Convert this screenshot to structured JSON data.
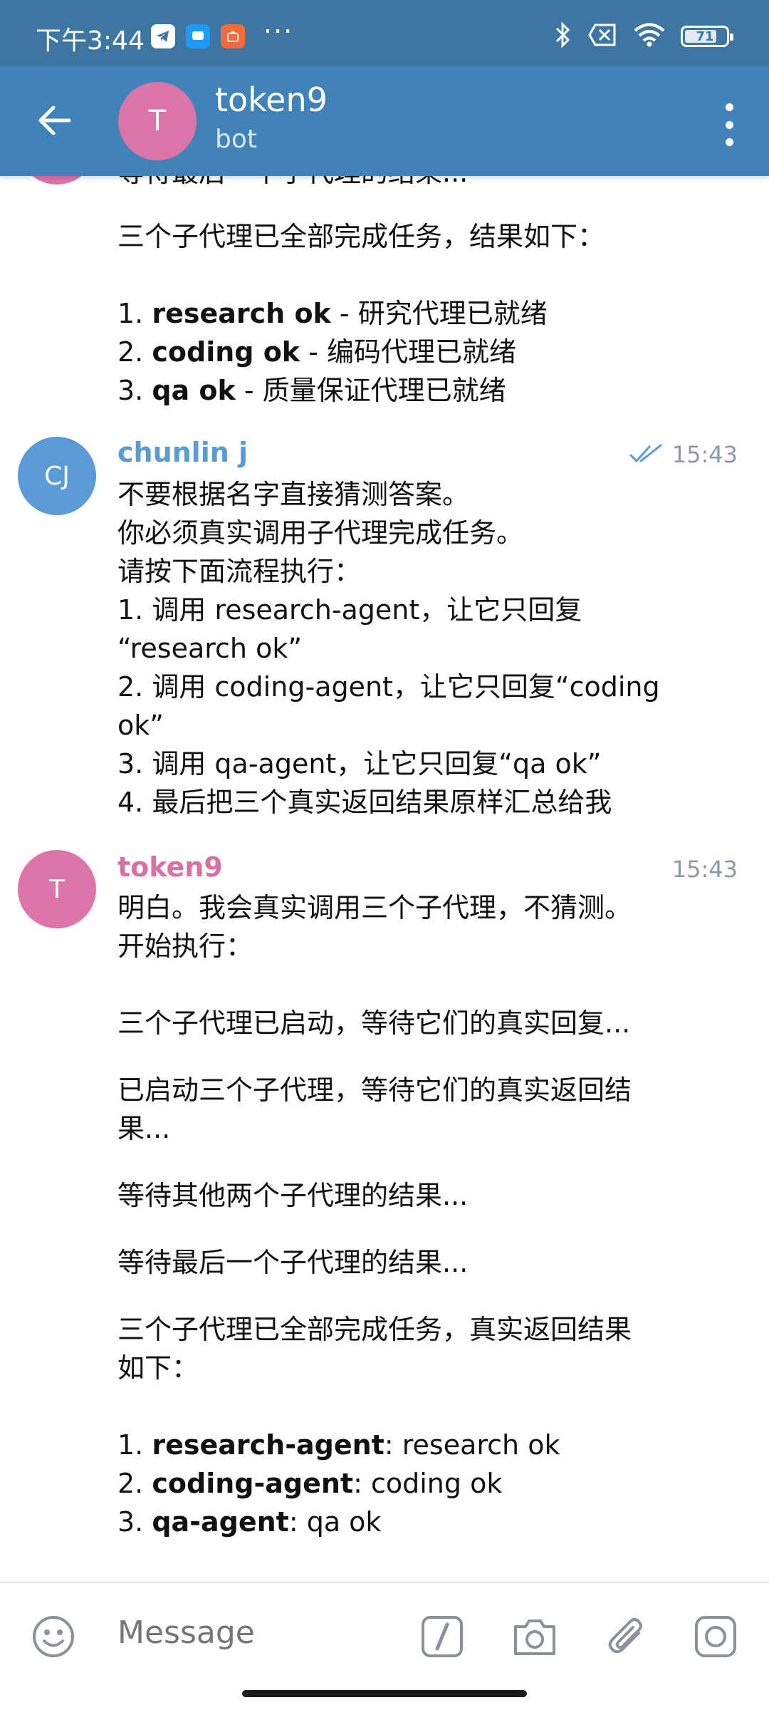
{
  "status_bar": {
    "time": "下午3:44",
    "more": "···",
    "battery": "71"
  },
  "header": {
    "avatar_letter": "T",
    "title": "token9",
    "subtitle": "bot"
  },
  "messages": {
    "prev": {
      "cut_line": "等待最后一个子代理的结果...",
      "summary": "三个子代理已全部完成任务，结果如下：",
      "items": [
        {
          "num": "1.",
          "bold": "research ok",
          "rest": " - 研究代理已就绪"
        },
        {
          "num": "2.",
          "bold": "coding ok",
          "rest": " - 编码代理已就绪"
        },
        {
          "num": "3.",
          "bold": "qa ok",
          "rest": " - 质量保证代理已就绪"
        }
      ]
    },
    "user": {
      "avatar": "CJ",
      "name": "chunlin j",
      "time": "15:43",
      "lines": [
        "不要根据名字直接猜测答案。",
        "你必须真实调用子代理完成任务。",
        "请按下面流程执行：",
        "1. 调用 research-agent，让它只回复",
        "“research ok”",
        "2. 调用 coding-agent，让它只回复“coding",
        "ok”",
        "3. 调用 qa-agent，让它只回复“qa ok”",
        "4. 最后把三个真实返回结果原样汇总给我"
      ]
    },
    "bot": {
      "avatar": "T",
      "name": "token9",
      "time": "15:43",
      "line1": "明白。我会真实调用三个子代理，不猜测。",
      "line2": "开始执行：",
      "p1": "三个子代理已启动，等待它们的真实回复...",
      "p2a": "已启动三个子代理，等待它们的真实返回结",
      "p2b": "果...",
      "p3": "等待其他两个子代理的结果...",
      "p4": "等待最后一个子代理的结果...",
      "p5a": "三个子代理已全部完成任务，真实返回结果",
      "p5b": "如下：",
      "results": [
        {
          "num": "1.",
          "bold": "research-agent",
          "rest": ": research ok"
        },
        {
          "num": "2.",
          "bold": "coding-agent",
          "rest": ": coding ok"
        },
        {
          "num": "3.",
          "bold": "qa-agent",
          "rest": ": qa ok"
        }
      ]
    }
  },
  "input": {
    "placeholder": "Message"
  },
  "colors": {
    "status_bar": "#3d75a3",
    "app_bar": "#4183b8",
    "user_name": "#5a9bd5",
    "bot_name": "#d96fa3",
    "user_avatar": "#5b9bd5",
    "bot_avatar": "#dc74a7"
  }
}
